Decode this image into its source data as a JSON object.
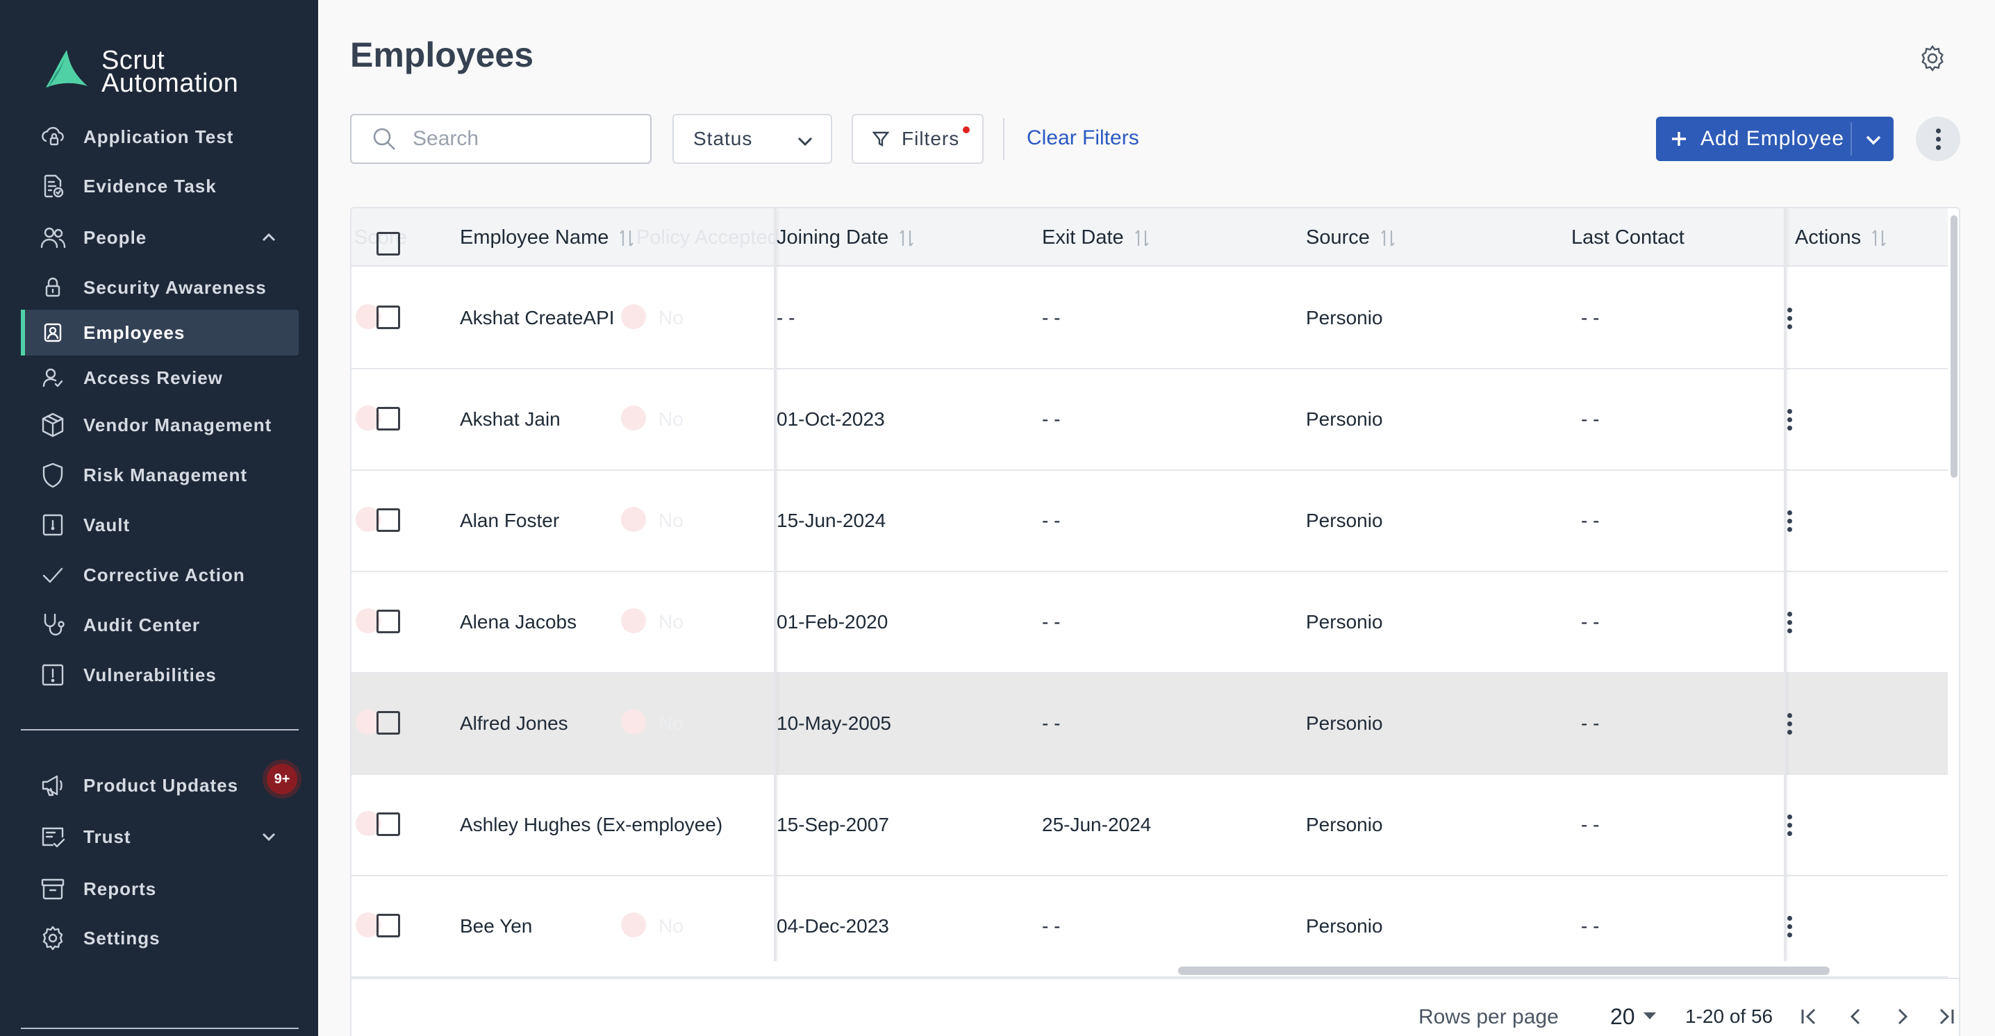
{
  "app": {
    "logo_line1": "Scrut",
    "logo_line2": "Automation",
    "accent_color": "#4fd1a5",
    "primary_color": "#2e5bb7",
    "sidebar_color": "#1d2939"
  },
  "sidebar": {
    "items": [
      {
        "label": "Application Test",
        "icon": "cloud-lock-icon"
      },
      {
        "label": "Evidence Task",
        "icon": "document-check-icon"
      },
      {
        "label": "People",
        "icon": "people-icon",
        "expanded": true
      },
      {
        "label": "Security Awareness",
        "icon": "lock-icon"
      },
      {
        "label": "Employees",
        "icon": "id-badge-icon",
        "active": true
      },
      {
        "label": "Access Review",
        "icon": "user-check-icon"
      },
      {
        "label": "Vendor Management",
        "icon": "box-icon"
      },
      {
        "label": "Risk Management",
        "icon": "shield-icon"
      },
      {
        "label": "Vault",
        "icon": "vault-icon"
      },
      {
        "label": "Corrective Action",
        "icon": "check-icon"
      },
      {
        "label": "Audit Center",
        "icon": "stethoscope-icon"
      },
      {
        "label": "Vulnerabilities",
        "icon": "alert-square-icon"
      }
    ],
    "bottom_items": [
      {
        "label": "Product Updates",
        "icon": "megaphone-icon",
        "badge": "9+"
      },
      {
        "label": "Trust",
        "icon": "trust-icon",
        "expandable": true
      },
      {
        "label": "Reports",
        "icon": "archive-icon"
      },
      {
        "label": "Settings",
        "icon": "gear-icon"
      }
    ]
  },
  "page": {
    "title": "Employees"
  },
  "toolbar": {
    "search_placeholder": "Search",
    "status_label": "Status",
    "filters_label": "Filters",
    "clear_filters_label": "Clear Filters",
    "add_employee_label": "Add Employee"
  },
  "table": {
    "columns": {
      "name": "Employee Name",
      "ghost_left": "Score",
      "ghost_policy": "Policy Accepted",
      "joining": "Joining Date",
      "exit": "Exit Date",
      "source": "Source",
      "last_contact": "Last Contact",
      "actions": "Actions"
    },
    "ghost_no": "No",
    "rows": [
      {
        "name": "Akshat CreateAPI",
        "joining": "- -",
        "exit": "- -",
        "source": "Personio",
        "last_contact": "- -"
      },
      {
        "name": "Akshat Jain",
        "joining": "01-Oct-2023",
        "exit": "- -",
        "source": "Personio",
        "last_contact": "- -"
      },
      {
        "name": "Alan Foster",
        "joining": "15-Jun-2024",
        "exit": "- -",
        "source": "Personio",
        "last_contact": "- -"
      },
      {
        "name": "Alena Jacobs",
        "joining": "01-Feb-2020",
        "exit": "- -",
        "source": "Personio",
        "last_contact": "- -"
      },
      {
        "name": "Alfred Jones",
        "joining": "10-May-2005",
        "exit": "- -",
        "source": "Personio",
        "last_contact": "- -",
        "highlighted": true
      },
      {
        "name": "Ashley Hughes (Ex-employee)",
        "joining": "15-Sep-2007",
        "exit": "25-Jun-2024",
        "source": "Personio",
        "last_contact": "- -"
      },
      {
        "name": "Bee Yen",
        "joining": "04-Dec-2023",
        "exit": "- -",
        "source": "Personio",
        "last_contact": "- -"
      }
    ]
  },
  "pagination": {
    "rows_per_page_label": "Rows per page",
    "rows_per_page": "20",
    "range": "1-20 of 56"
  }
}
